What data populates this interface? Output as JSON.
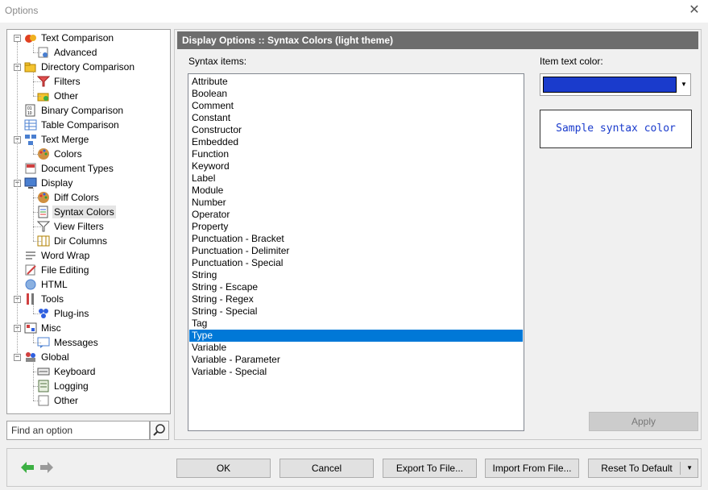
{
  "window": {
    "title": "Options",
    "close_glyph": "✕"
  },
  "tree": {
    "items": [
      {
        "label": "Text Comparison",
        "icon": "text-comparison-icon",
        "level": 0,
        "expander": "−"
      },
      {
        "label": "Advanced",
        "icon": "advanced-settings-icon",
        "level": 1
      },
      {
        "label": "Directory Comparison",
        "icon": "folder-comparison-icon",
        "level": 0,
        "expander": "−"
      },
      {
        "label": "Filters",
        "icon": "filter-icon",
        "level": 1
      },
      {
        "label": "Other",
        "icon": "folder-other-icon",
        "level": 1
      },
      {
        "label": "Binary Comparison",
        "icon": "binary-icon",
        "level": 0
      },
      {
        "label": "Table Comparison",
        "icon": "table-icon",
        "level": 0
      },
      {
        "label": "Text Merge",
        "icon": "merge-icon",
        "level": 0,
        "expander": "−"
      },
      {
        "label": "Colors",
        "icon": "palette-icon",
        "level": 1
      },
      {
        "label": "Document Types",
        "icon": "document-types-icon",
        "level": 0
      },
      {
        "label": "Display",
        "icon": "monitor-icon",
        "level": 0,
        "expander": "−"
      },
      {
        "label": "Diff Colors",
        "icon": "palette-icon",
        "level": 1
      },
      {
        "label": "Syntax Colors",
        "icon": "syntax-colors-icon",
        "level": 1,
        "selected": true
      },
      {
        "label": "View Filters",
        "icon": "funnel-icon",
        "level": 1
      },
      {
        "label": "Dir Columns",
        "icon": "columns-icon",
        "level": 1
      },
      {
        "label": "Word Wrap",
        "icon": "word-wrap-icon",
        "level": 0
      },
      {
        "label": "File Editing",
        "icon": "edit-icon",
        "level": 0
      },
      {
        "label": "HTML",
        "icon": "html-icon",
        "level": 0
      },
      {
        "label": "Tools",
        "icon": "tools-icon",
        "level": 0,
        "expander": "−"
      },
      {
        "label": "Plug-ins",
        "icon": "plugin-icon",
        "level": 1
      },
      {
        "label": "Misc",
        "icon": "misc-icon",
        "level": 0,
        "expander": "−"
      },
      {
        "label": "Messages",
        "icon": "message-icon",
        "level": 1
      },
      {
        "label": "Global",
        "icon": "users-icon",
        "level": 0,
        "expander": "−"
      },
      {
        "label": "Keyboard",
        "icon": "keyboard-icon",
        "level": 1
      },
      {
        "label": "Logging",
        "icon": "logging-icon",
        "level": 1
      },
      {
        "label": "Other",
        "icon": "other-icon",
        "level": 1
      }
    ]
  },
  "search": {
    "placeholder": "Find an option",
    "icon": "search-icon"
  },
  "panel": {
    "header": "Display Options :: Syntax Colors (light theme)",
    "syntax_items_label": "Syntax items:",
    "item_text_color_label": "Item text color:",
    "items": [
      {
        "label": "Attribute"
      },
      {
        "label": "Boolean"
      },
      {
        "label": "Comment"
      },
      {
        "label": "Constant"
      },
      {
        "label": "Constructor"
      },
      {
        "label": "Embedded"
      },
      {
        "label": "Function"
      },
      {
        "label": "Keyword"
      },
      {
        "label": "Label"
      },
      {
        "label": "Module"
      },
      {
        "label": "Number"
      },
      {
        "label": "Operator"
      },
      {
        "label": "Property"
      },
      {
        "label": "Punctuation - Bracket"
      },
      {
        "label": "Punctuation - Delimiter"
      },
      {
        "label": "Punctuation - Special"
      },
      {
        "label": "String"
      },
      {
        "label": "String - Escape"
      },
      {
        "label": "String - Regex"
      },
      {
        "label": "String - Special"
      },
      {
        "label": "Tag"
      },
      {
        "label": "Type",
        "selected": true
      },
      {
        "label": "Variable"
      },
      {
        "label": "Variable - Parameter"
      },
      {
        "label": "Variable - Special"
      }
    ],
    "selected_color": "#1a3bcc",
    "sample_text": "Sample syntax color",
    "apply_label": "Apply"
  },
  "footer": {
    "ok": "OK",
    "cancel": "Cancel",
    "export": "Export To File...",
    "import": "Import From File...",
    "reset": "Reset To Default"
  },
  "colors": {
    "selection": "#0078d7",
    "header_bg": "#6d6d6d",
    "nav_back": "#3cb043",
    "nav_forward": "#9a9a9a"
  }
}
